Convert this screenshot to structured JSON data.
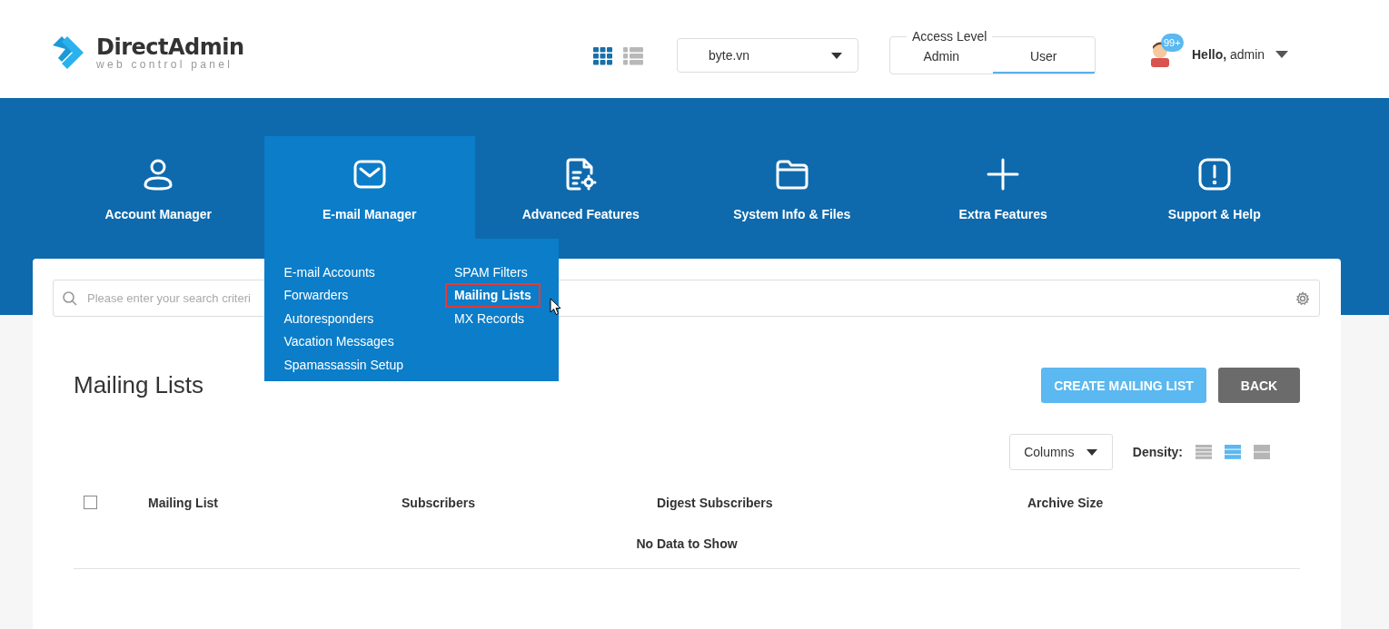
{
  "logo": {
    "name": "DirectAdmin",
    "tagline": "web control panel"
  },
  "view_toggle": [
    {
      "kind": "grid",
      "selected": true
    },
    {
      "kind": "list",
      "selected": false
    }
  ],
  "domain_select": {
    "value": "byte.vn"
  },
  "access_level": {
    "label": "Access Level",
    "options": [
      {
        "label": "Admin",
        "selected": false
      },
      {
        "label": "User",
        "selected": true
      }
    ]
  },
  "user": {
    "badge": "99+",
    "greeting": "Hello,",
    "name": "admin"
  },
  "nav": [
    {
      "label": "Account Manager",
      "selected": false
    },
    {
      "label": "E-mail Manager",
      "selected": true
    },
    {
      "label": "Advanced Features",
      "selected": false
    },
    {
      "label": "System Info & Files",
      "selected": false
    },
    {
      "label": "Extra Features",
      "selected": false
    },
    {
      "label": "Support & Help",
      "selected": false
    }
  ],
  "submenu": {
    "columns": [
      [
        {
          "label": "E-mail Accounts",
          "selected": false
        },
        {
          "label": "Forwarders",
          "selected": false
        },
        {
          "label": "Autoresponders",
          "selected": false
        },
        {
          "label": "Vacation Messages",
          "selected": false
        },
        {
          "label": "Spamassassin Setup",
          "selected": false
        }
      ],
      [
        {
          "label": "SPAM Filters",
          "selected": false
        },
        {
          "label": "Mailing Lists",
          "selected": true
        },
        {
          "label": "MX Records",
          "selected": false
        }
      ]
    ]
  },
  "search": {
    "placeholder": "Please enter your search criteri"
  },
  "page_title": "Mailing Lists",
  "buttons": [
    {
      "label": "CREATE MAILING LIST",
      "kind": "primary"
    },
    {
      "label": "BACK",
      "kind": "secondary"
    }
  ],
  "columns_button": "Columns",
  "density": {
    "label": "Density:",
    "options": [
      {
        "kind": "compact",
        "selected": false
      },
      {
        "kind": "normal",
        "selected": true
      },
      {
        "kind": "wide",
        "selected": false
      }
    ]
  },
  "table": {
    "select_all_checked": false,
    "columns": [
      "Mailing List",
      "Subscribers",
      "Digest Subscribers",
      "Archive Size"
    ],
    "empty_message": "No Data to Show"
  }
}
